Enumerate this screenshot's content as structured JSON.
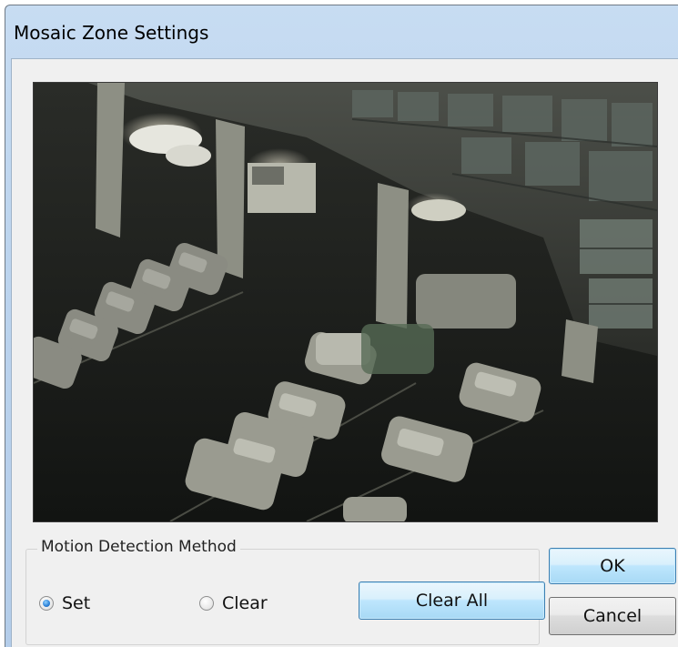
{
  "window": {
    "title": "Mosaic Zone Settings"
  },
  "camera": {
    "icon": "camera-feed-image"
  },
  "motion_detection": {
    "group_label": "Motion Detection Method",
    "options": [
      {
        "label": "Set",
        "checked": true
      },
      {
        "label": "Clear",
        "checked": false
      }
    ],
    "clear_all_label": "Clear All"
  },
  "buttons": {
    "ok_label": "OK",
    "cancel_label": "Cancel"
  },
  "colors": {
    "accent": "#3c7fb1",
    "title_bar": "#bcd4ee",
    "client_bg": "#f0f0f0"
  }
}
